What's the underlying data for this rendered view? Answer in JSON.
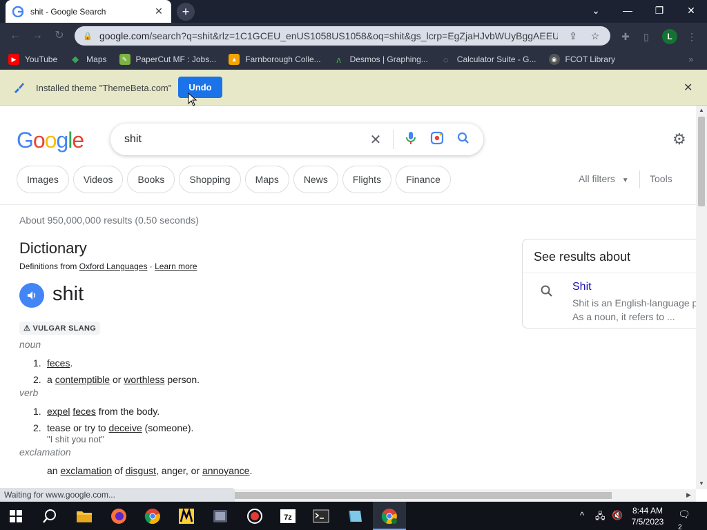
{
  "browser": {
    "tab_title": "shit - Google Search",
    "tab_close": "✕",
    "new_tab": "+",
    "url_host": "google.com",
    "url_rest": "/search?q=shit&rlz=1C1GCEU_enUS1058US1058&oq=shit&gs_lcrp=EgZjaHJvbWUyBggAEEUY...",
    "profile_initial": "L",
    "bookmarks": [
      {
        "label": "YouTube",
        "icon": "youtube-icon",
        "color": "#ff0000"
      },
      {
        "label": "Maps",
        "icon": "maps-icon",
        "color": "#34a853"
      },
      {
        "label": "PaperCut MF : Jobs...",
        "icon": "papercut-icon",
        "color": "#7cb342"
      },
      {
        "label": "Farnborough Colle...",
        "icon": "college-icon",
        "color": "#f4a300"
      },
      {
        "label": "Desmos | Graphing...",
        "icon": "desmos-icon",
        "color": "#2e7d32"
      },
      {
        "label": "Calculator Suite - G...",
        "icon": "geogebra-icon",
        "color": "#666666"
      },
      {
        "label": "FCOT Library",
        "icon": "library-icon",
        "color": "#555555"
      }
    ],
    "bookmarks_more": "»",
    "infobar_message": "Installed theme \"ThemeBeta.com\"",
    "infobar_undo": "Undo",
    "infobar_close": "✕",
    "status_text": "Waiting for www.google.com..."
  },
  "search": {
    "logo": [
      "G",
      "o",
      "o",
      "g",
      "l",
      "e"
    ],
    "logo_colors": [
      "#4285f4",
      "#ea4335",
      "#fbbc05",
      "#4285f4",
      "#34a853",
      "#ea4335"
    ],
    "query": "shit",
    "chips": [
      "Images",
      "Videos",
      "Books",
      "Shopping",
      "Maps",
      "News",
      "Flights",
      "Finance"
    ],
    "all_filters": "All filters",
    "tools": "Tools",
    "stats": "About 950,000,000 results (0.50 seconds)"
  },
  "dictionary": {
    "title": "Dictionary",
    "defs_from_prefix": "Definitions from ",
    "source_link": "Oxford Languages",
    "separator": " · ",
    "learn_more": "Learn more",
    "word": "shit",
    "label": "VULGAR SLANG",
    "noun": "noun",
    "noun_def1_num": "1.",
    "noun_def1": "feces",
    "noun_def1_end": ".",
    "noun_def2_num": "2.",
    "noun_def2_a": "a ",
    "noun_def2_w1": "contemptible",
    "noun_def2_or": " or ",
    "noun_def2_w2": "worthless",
    "noun_def2_end": " person.",
    "verb": "verb",
    "verb_def1_num": "1.",
    "verb_def1_w1": "expel",
    "verb_def1_w2": "feces",
    "verb_def1_end": " from the body.",
    "verb_def2_num": "2.",
    "verb_def2_a": "tease or try to ",
    "verb_def2_w": "deceive",
    "verb_def2_end": " (someone).",
    "verb_def2_example": "\"I shit you not\"",
    "exclamation": "exclamation",
    "excl_a": "an ",
    "excl_w1": "exclamation",
    "excl_of": " of ",
    "excl_w2": "disgust",
    "excl_mid": ", anger, or ",
    "excl_w3": "annoyance",
    "excl_end": "."
  },
  "knowledge_panel": {
    "title": "See results about",
    "name": "Shit",
    "desc1": "Shit is an English-language p",
    "desc2": "As a noun, it refers to ..."
  },
  "taskbar": {
    "time": "8:44 AM",
    "date": "7/5/2023",
    "notification_count": "2",
    "apps": [
      "start-icon",
      "search-icon",
      "file-explorer-icon",
      "firefox-icon",
      "chrome-icon",
      "miro-icon",
      "video-editor-icon",
      "record-icon",
      "7zip-icon",
      "terminal-icon",
      "notes-icon",
      "chrome-profile-icon"
    ]
  }
}
